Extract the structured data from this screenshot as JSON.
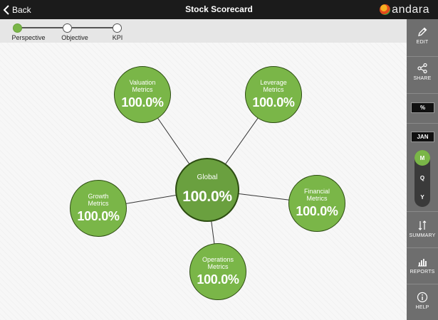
{
  "header": {
    "back_label": "Back",
    "title": "Stock Scorecard",
    "brand": "andara"
  },
  "steps": [
    {
      "label": "Perspective",
      "active": true
    },
    {
      "label": "Objective",
      "active": false
    },
    {
      "label": "KPI",
      "active": false
    }
  ],
  "diagram": {
    "center": {
      "label": "Global",
      "value": "100.0%"
    },
    "nodes": [
      {
        "label": "Valuation\nMetrics",
        "value": "100.0%"
      },
      {
        "label": "Leverage\nMetrics",
        "value": "100.0%"
      },
      {
        "label": "Growth\nMetrics",
        "value": "100.0%"
      },
      {
        "label": "Financial\nMetrics",
        "value": "100.0%"
      },
      {
        "label": "Operations\nMetrics",
        "value": "100.0%"
      }
    ]
  },
  "sidebar": {
    "edit": "EDIT",
    "share": "SHARE",
    "format": "%",
    "month": "JAN",
    "periods": [
      "M",
      "Q",
      "Y"
    ],
    "selected_period": "M",
    "summary": "SUMMARY",
    "reports": "REPORTS",
    "help": "HELP"
  },
  "colors": {
    "node_fill": "#7ab648",
    "node_border": "#2d4d12",
    "topbar": "#1b1b1b",
    "sidebar": "#6e6e6e"
  }
}
